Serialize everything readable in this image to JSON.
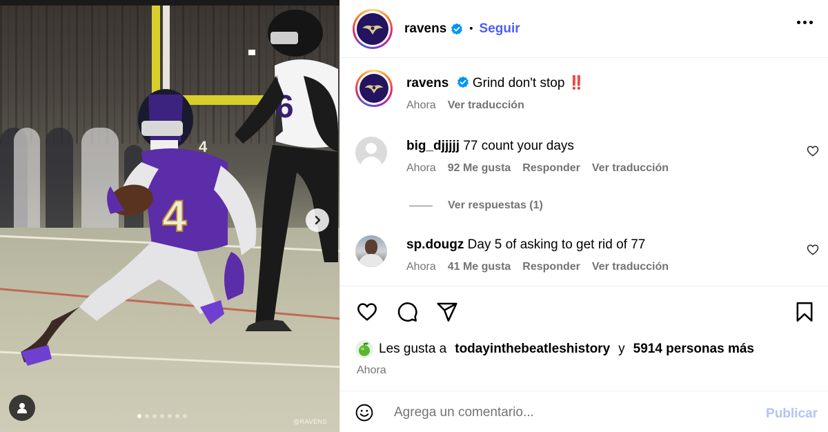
{
  "media": {
    "watermark": "@RAVENS",
    "carousel_count": 7,
    "carousel_active": 0
  },
  "header": {
    "username": "ravens",
    "separator": "•",
    "follow_label": "Seguir"
  },
  "caption": {
    "username": "ravens",
    "text": "Grind don't stop",
    "emoji": "‼️",
    "time": "Ahora",
    "translate_label": "Ver traducción"
  },
  "comments": [
    {
      "username": "big_djjjjj",
      "text": "77 count your days",
      "time": "Ahora",
      "likes": "92 Me gusta",
      "reply_label": "Responder",
      "translate_label": "Ver traducción",
      "view_replies": "Ver respuestas (1)"
    },
    {
      "username": "sp.dougz",
      "text": "Day 5 of asking to get rid of 77",
      "time": "Ahora",
      "likes": "41 Me gusta",
      "reply_label": "Responder",
      "translate_label": "Ver traducción"
    }
  ],
  "likes": {
    "prefix": "Les gusta a",
    "user": "todayinthebeatleshistory",
    "joiner": "y",
    "others": "5914 personas más"
  },
  "post_time": "Ahora",
  "comment_box": {
    "placeholder": "Agrega un comentario...",
    "post_label": "Publicar"
  },
  "colors": {
    "link_blue": "#4a5df9",
    "verified_blue": "#0095f6",
    "post_disabled": "#b3c3f9",
    "ravens_purple": "#24135f",
    "muted_text": "#737373"
  }
}
